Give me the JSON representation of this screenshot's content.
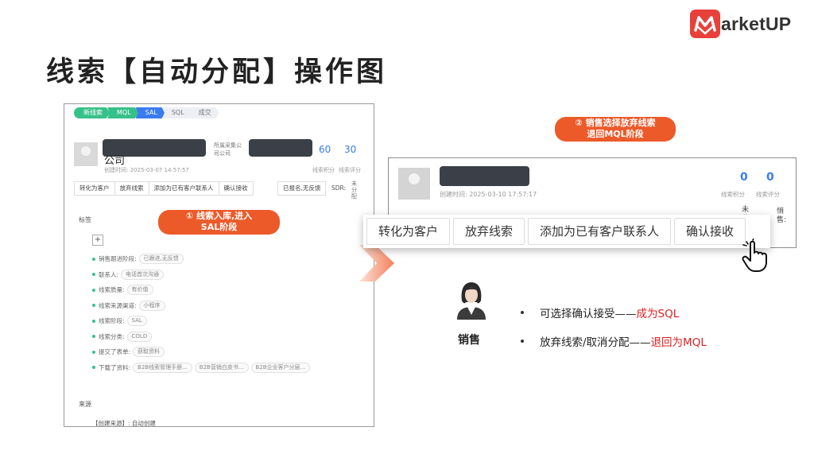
{
  "brand": {
    "logo_text": "arketUP",
    "accent": "#e8403a"
  },
  "slide_title": "线索【自动分配】操作图",
  "left_panel": {
    "stages": [
      {
        "label": "新线索",
        "state": "done"
      },
      {
        "label": "MQL",
        "state": "done"
      },
      {
        "label": "SAL",
        "state": "active"
      },
      {
        "label": "SQL",
        "state": "todo"
      },
      {
        "label": "成交",
        "state": "todo"
      }
    ],
    "company_suffix": "公司",
    "created": "创建时间: 2025-03-07 14:57:57",
    "owner_lines": [
      "所属采集公",
      "司公司"
    ],
    "score_value": "60",
    "rating_value": "30",
    "score_label": "线索积分",
    "rating_label": "线索评分",
    "actions": [
      "转化为客户",
      "放弃线索",
      "添加为已有客户联系人",
      "确认接收"
    ],
    "extra_action": "已报名,无反馈",
    "sdr_label": "SDR:",
    "sdr_value": "未分配",
    "tags_heading": "标签",
    "tag_rows": [
      {
        "label": "销售跟进阶段:",
        "chips": [
          "已跟进,无反馈"
        ]
      },
      {
        "label": "联系人:",
        "chips": [
          "电话首次沟通"
        ]
      },
      {
        "label": "线索质量:",
        "chips": [
          "有价值"
        ]
      },
      {
        "label": "线索来源渠道:",
        "chips": [
          "小程序"
        ]
      },
      {
        "label": "线索阶段:",
        "chips": [
          "SAL"
        ]
      },
      {
        "label": "线索分类:",
        "chips": [
          "COLD"
        ]
      },
      {
        "label": "提交了表单:",
        "chips": [
          "获取资料"
        ]
      },
      {
        "label": "下载了资料:",
        "chips": [
          "B2B线索管理手册...",
          "B2B营销白皮书...",
          "B2B企业客户分层..."
        ]
      }
    ],
    "source_heading": "来源",
    "source_line": "【创建来源】: 自动创建"
  },
  "callout_1": "① 线索入库,进入\nSAL阶段",
  "callout_2": "② 销售选择放弃线索\n退回MQL阶段",
  "right_panel": {
    "created": "创建时间: 2025-03-10 17:57:17",
    "score_value": "0",
    "rating_value": "0",
    "score_label": "线索积分",
    "rating_label": "线索评分",
    "side_a": "未\n分",
    "side_b": "悄\n售:"
  },
  "action_bar": {
    "convert": "转化为客户",
    "abandon": "放弃线索",
    "add_contact": "添加为已有客户联系人",
    "confirm": "确认接收"
  },
  "role_label": "销售",
  "bullets": [
    {
      "text": "可选择确认接受——",
      "highlight": "成为SQL"
    },
    {
      "text": "放弃线索/取消分配——",
      "highlight": "退回为MQL"
    }
  ]
}
